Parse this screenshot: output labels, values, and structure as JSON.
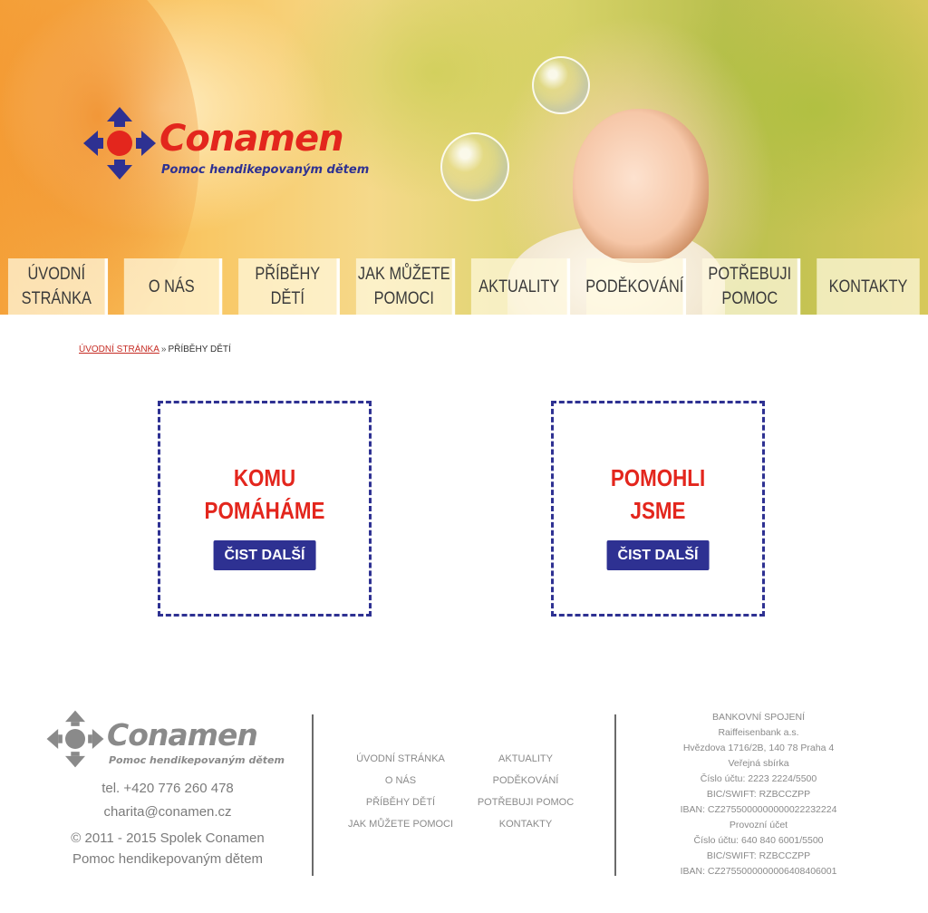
{
  "header": {
    "logo": {
      "brand": "Conamen",
      "tagline": "Pomoc hendikepovaným dětem"
    }
  },
  "nav": [
    {
      "label": [
        "ÚVODNÍ",
        "STRÁNKA"
      ]
    },
    {
      "label": [
        "O NÁS"
      ]
    },
    {
      "label": [
        "PŘÍBĚHY",
        "DĚTÍ"
      ]
    },
    {
      "label": [
        "JAK MŮŽETE",
        "POMOCI"
      ]
    },
    {
      "label": [
        "AKTUALITY"
      ]
    },
    {
      "label": [
        "PODĚKOVÁNÍ"
      ]
    },
    {
      "label": [
        "POTŘEBUJI",
        "POMOC"
      ]
    },
    {
      "label": [
        "KONTAKTY"
      ]
    }
  ],
  "breadcrumb": {
    "home": "ÚVODNÍ STRÁNKA",
    "separator": "»",
    "current": "PŘÍBĚHY DĚTÍ"
  },
  "cards": [
    {
      "title": [
        "KOMU",
        "POMÁHÁME"
      ],
      "button": "ČIST DALŠÍ"
    },
    {
      "title": [
        "POMOHLI",
        "JSME"
      ],
      "button": "ČIST DALŠÍ"
    }
  ],
  "footer": {
    "logo": {
      "brand": "Conamen",
      "tagline": "Pomoc hendikepovaným dětem"
    },
    "phone": "tel. +420 776 260 478",
    "email": "charita@conamen.cz",
    "copyright": "© 2011 - 2015 Spolek Conamen",
    "subtitle": "Pomoc hendikepovaným dětem",
    "nav_col1": [
      "ÚVODNÍ STRÁNKA",
      "O NÁS",
      "PŘÍBĚHY DĚTÍ",
      "JAK MŮŽETE POMOCI"
    ],
    "nav_col2": [
      "AKTUALITY",
      "PODĚKOVÁNÍ",
      "POTŘEBUJI POMOC",
      "KONTAKTY"
    ],
    "bank": [
      "BANKOVNÍ SPOJENÍ",
      "Raiffeisenbank a.s.",
      "Hvězdova 1716/2B, 140 78 Praha 4",
      "Veřejná sbírka",
      "Číslo účtu: 2223 2224/5500",
      "BIC/SWIFT: RZBCCZPP",
      "IBAN: CZ2755000000000022232224",
      "Provozní účet",
      "Číslo účtu: 640 840 6001/5500",
      "BIC/SWIFT: RZBCCZPP",
      "IBAN: CZ2755000000006408406001"
    ]
  },
  "colors": {
    "brand_red": "#e3261d",
    "brand_blue": "#2e3192",
    "footer_gray": "#8a8a8a"
  }
}
